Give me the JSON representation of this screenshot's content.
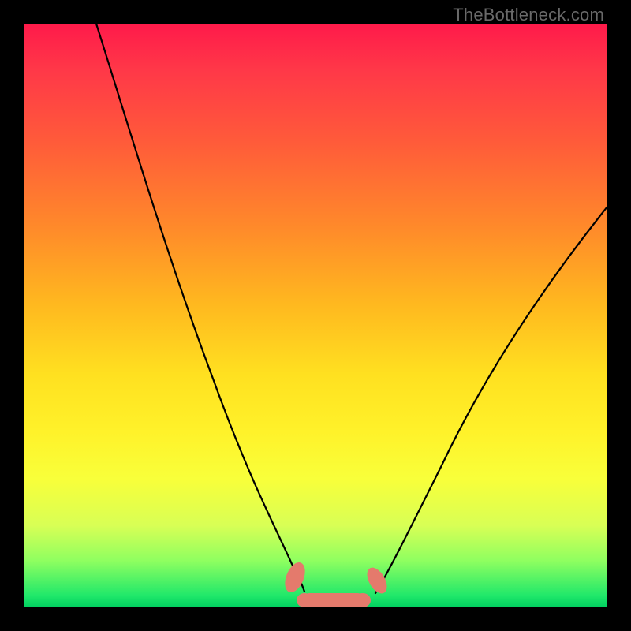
{
  "watermark": "TheBottleneck.com",
  "colors": {
    "frame": "#000000",
    "gradient_top": "#ff1a4a",
    "gradient_mid1": "#ff8a2a",
    "gradient_mid2": "#fff22a",
    "gradient_bottom": "#00d060",
    "curve": "#000000",
    "blob": "#e47a6c"
  },
  "chart_data": {
    "type": "line",
    "title": "",
    "xlabel": "",
    "ylabel": "",
    "xlim": [
      0,
      100
    ],
    "ylim": [
      0,
      100
    ],
    "series": [
      {
        "name": "left-curve",
        "x": [
          12.5,
          15,
          20,
          25,
          30,
          35,
          40,
          42,
          44,
          46,
          47,
          48
        ],
        "y": [
          100,
          90,
          72,
          52,
          35,
          22,
          12,
          8,
          5,
          3,
          2.5,
          1.8
        ]
      },
      {
        "name": "right-curve",
        "x": [
          60,
          62,
          66,
          70,
          75,
          80,
          85,
          90,
          95,
          100
        ],
        "y": [
          2,
          4,
          8,
          13,
          22,
          31,
          41,
          51,
          60,
          68
        ]
      },
      {
        "name": "optimal-zone-blobs",
        "x": [
          46,
          50,
          54,
          58,
          60
        ],
        "y": [
          2.5,
          1.0,
          0.8,
          1.0,
          3.5
        ]
      }
    ]
  }
}
